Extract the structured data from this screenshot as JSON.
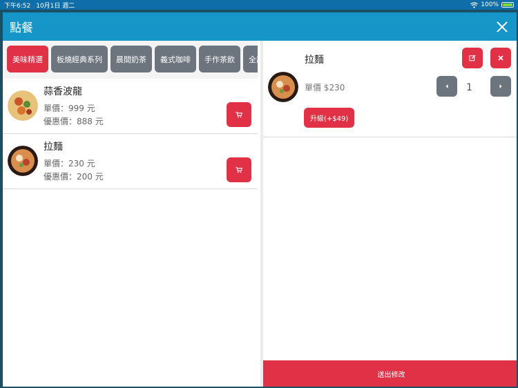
{
  "statusbar": {
    "time": "下午6:52",
    "date": "10月1日 週二",
    "battery": "100%"
  },
  "header": {
    "title": "點餐"
  },
  "categories": [
    {
      "label": "美味精選",
      "active": true
    },
    {
      "label": "板燒經典系列",
      "active": false
    },
    {
      "label": "晨間奶茶",
      "active": false
    },
    {
      "label": "義式咖啡",
      "active": false
    },
    {
      "label": "手作茶飲",
      "active": false
    },
    {
      "label": "全部品",
      "active": false
    }
  ],
  "menu": [
    {
      "name": "蒜香波龍",
      "price": "單價：999 元",
      "sale": "優惠價：888 元"
    },
    {
      "name": "拉麵",
      "price": "單價：230 元",
      "sale": "優惠價：200 元"
    }
  ],
  "order": {
    "name": "拉麵",
    "unit_price": "單價 $230",
    "quantity": "1",
    "upgrade_label": "升級(+$49)"
  },
  "submit_label": "送出修改",
  "colors": {
    "accent": "#e03146",
    "header": "#1595c8",
    "gray_button": "#6c757d"
  },
  "icons": [
    "close-icon",
    "cart-icon",
    "edit-icon",
    "remove-icon",
    "chevron-left-icon",
    "chevron-right-icon",
    "wifi-icon",
    "battery-icon"
  ]
}
